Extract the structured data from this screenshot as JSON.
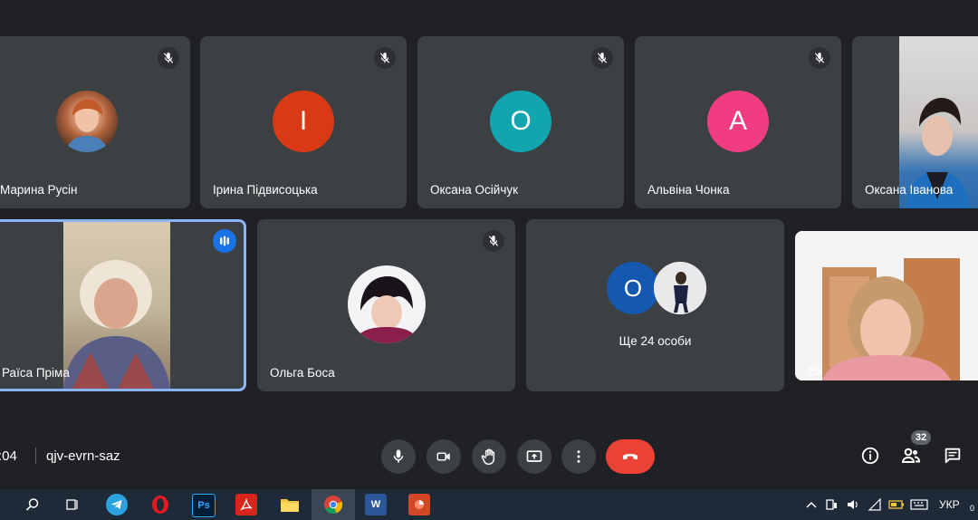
{
  "participants": [
    {
      "name": "Марина Русін",
      "type": "photo"
    },
    {
      "name": "Ірина Підвисоцька",
      "initial": "I",
      "color": "#d93a16"
    },
    {
      "name": "Оксана Осійчук",
      "initial": "O",
      "color": "#12a4af"
    },
    {
      "name": "Альвіна Чонка",
      "initial": "A",
      "color": "#f03d82"
    },
    {
      "name": "Оксана Іванова",
      "type": "video"
    },
    {
      "name": "Раїса Пріма",
      "type": "video",
      "speaking": true
    },
    {
      "name": "Ольга Боса",
      "type": "photo"
    },
    {
      "name": "Ви",
      "type": "video"
    }
  ],
  "others": {
    "label": "Ще 24 особи",
    "initial": "O",
    "color": "#1558b0"
  },
  "meeting": {
    "time": ":04",
    "code": "qjv-evrn-saz"
  },
  "people_count": "32",
  "taskbar": {
    "ps_label": "Ps",
    "word_label": "W",
    "lang": "УКР",
    "clock_partial": "0"
  },
  "colors": {
    "background": "#202124",
    "tile": "#3c4043",
    "end_call": "#ea4335",
    "active_border": "#8ab4f8"
  }
}
